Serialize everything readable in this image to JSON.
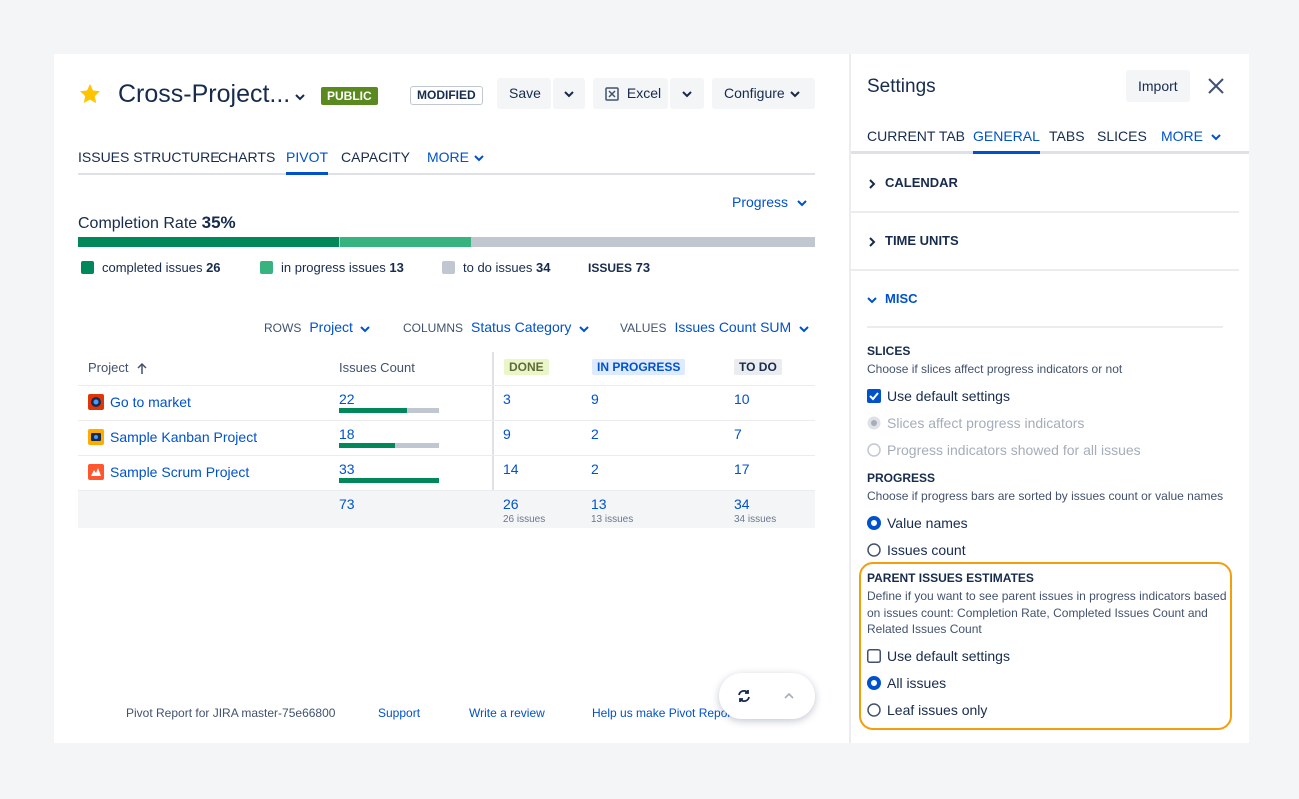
{
  "header": {
    "title": "Cross-Project...",
    "public_badge": "PUBLIC",
    "modified_badge": "MODIFIED",
    "save_label": "Save",
    "excel_label": "Excel",
    "configure_label": "Configure"
  },
  "tabs": [
    "ISSUES STRUCTURE",
    "CHARTS",
    "PIVOT",
    "CAPACITY",
    "MORE"
  ],
  "active_tab": "PIVOT",
  "view_select": "Progress",
  "completion": {
    "label": "Completion Rate",
    "value": "35%"
  },
  "progress_bar": {
    "completed": 26,
    "in_progress": 13,
    "to_do": 34,
    "total": 73
  },
  "legend": {
    "completed_label": "completed issues",
    "completed_value": "26",
    "inprogress_label": "in progress issues",
    "inprogress_value": "13",
    "todo_label": "to do issues",
    "todo_value": "34",
    "issues_label": "ISSUES",
    "issues_value": "73"
  },
  "config": {
    "rows_label": "ROWS",
    "rows_value": "Project",
    "columns_label": "COLUMNS",
    "columns_value": "Status Category",
    "values_label": "VALUES",
    "values_value": "Issues Count SUM"
  },
  "table": {
    "headers": {
      "project": "Project",
      "count": "Issues Count",
      "done": "DONE",
      "in_progress": "IN PROGRESS",
      "to_do": "TO DO"
    },
    "rows": [
      {
        "project": "Go to market",
        "count": "22",
        "done": "3",
        "in_progress": "9",
        "to_do": "10",
        "fill": 0.68
      },
      {
        "project": "Sample Kanban Project",
        "count": "18",
        "done": "9",
        "in_progress": "2",
        "to_do": "7",
        "fill": 0.56
      },
      {
        "project": "Sample Scrum Project",
        "count": "33",
        "done": "14",
        "in_progress": "2",
        "to_do": "17",
        "fill": 1.0
      }
    ],
    "totals": {
      "count": "73",
      "done": "26",
      "done_sub": "26 issues",
      "in_progress": "13",
      "in_progress_sub": "13 issues",
      "to_do": "34",
      "to_do_sub": "34 issues"
    }
  },
  "footer": {
    "version": "Pivot Report for JIRA master-75e66800",
    "support": "Support",
    "review": "Write a review",
    "help": "Help us make Pivot Report"
  },
  "settings": {
    "title": "Settings",
    "import_label": "Import",
    "tabs": [
      "CURRENT TAB",
      "GENERAL",
      "TABS",
      "SLICES",
      "MORE"
    ],
    "active_tab": "GENERAL",
    "sections": {
      "calendar": "CALENDAR",
      "time_units": "TIME UNITS",
      "misc": "MISC"
    },
    "slices": {
      "title": "SLICES",
      "desc": "Choose if slices affect progress indicators or not",
      "use_default": "Use default settings",
      "opt1": "Slices affect progress indicators",
      "opt2": "Progress indicators showed for all issues"
    },
    "progress": {
      "title": "PROGRESS",
      "desc": "Choose if progress bars are sorted by issues count or value names",
      "opt1": "Value names",
      "opt2": "Issues count"
    },
    "parent": {
      "title": "PARENT ISSUES ESTIMATES",
      "desc": "Define if you want to see parent issues in progress indicators based on issues count: Completion Rate, Completed Issues Count and Related Issues Count",
      "use_default": "Use default settings",
      "opt1": "All issues",
      "opt2": "Leaf issues only"
    }
  },
  "colors": {
    "completed": "#00875a",
    "in_progress": "#36b37e",
    "to_do": "#c1c7d0",
    "accent": "#0052cc",
    "highlight": "#f59e0b"
  }
}
